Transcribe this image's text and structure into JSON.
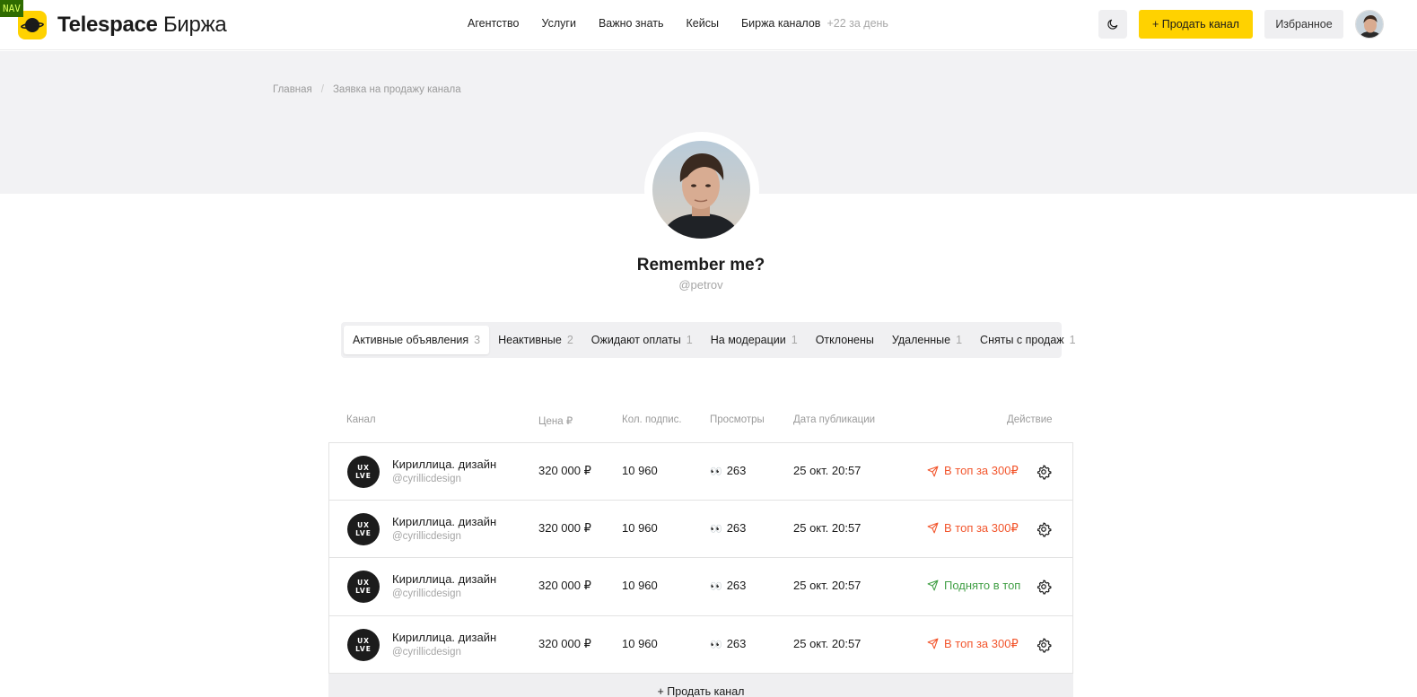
{
  "nav_tag": "NAV",
  "brand": {
    "name_bold": "Telespace",
    "name_light": "Биржа"
  },
  "menu": {
    "items": [
      "Агентство",
      "Услуги",
      "Важно знать",
      "Кейсы",
      "Биржа каналов"
    ],
    "exchange_extra": "+22 за день"
  },
  "header_actions": {
    "sell_label": "+ Продать канал",
    "favorites_label": "Избранное"
  },
  "breadcrumb": {
    "home": "Главная",
    "separator": "/",
    "current": "Заявка на продажу канала"
  },
  "profile": {
    "name": "Remember me?",
    "handle": "@petrov"
  },
  "tabs": [
    {
      "label": "Активные объявления",
      "count": "3",
      "active": true
    },
    {
      "label": "Неактивные",
      "count": "2"
    },
    {
      "label": "Ожидают оплаты",
      "count": "1"
    },
    {
      "label": "На модерации",
      "count": "1"
    },
    {
      "label": "Отклонены",
      "count": ""
    },
    {
      "label": "Удаленные",
      "count": "1"
    },
    {
      "label": "Сняты с продаж",
      "count": "1"
    }
  ],
  "table": {
    "columns": {
      "channel": "Канал",
      "price": "Цена ₽",
      "subscribers": "Кол. подпис.",
      "views": "Просмотры",
      "date": "Дата публикации",
      "action": "Действие"
    },
    "rows": [
      {
        "avatar_l1": "UX",
        "avatar_l2": "LVE",
        "title": "Кириллица. дизайн",
        "handle": "@cyrillicdesign",
        "price": "320 000 ₽",
        "subscribers": "10 960",
        "views": "263",
        "date": "25 окт. 20:57",
        "action": "В топ за 300₽",
        "action_state": "promo"
      },
      {
        "avatar_l1": "UX",
        "avatar_l2": "LVE",
        "title": "Кириллица. дизайн",
        "handle": "@cyrillicdesign",
        "price": "320 000 ₽",
        "subscribers": "10 960",
        "views": "263",
        "date": "25 окт. 20:57",
        "action": "В топ за 300₽",
        "action_state": "promo"
      },
      {
        "avatar_l1": "UX",
        "avatar_l2": "LVE",
        "title": "Кириллица. дизайн",
        "handle": "@cyrillicdesign",
        "price": "320 000 ₽",
        "subscribers": "10 960",
        "views": "263",
        "date": "25 окт. 20:57",
        "action": "Поднято в топ",
        "action_state": "done"
      },
      {
        "avatar_l1": "UX",
        "avatar_l2": "LVE",
        "title": "Кириллица. дизайн",
        "handle": "@cyrillicdesign",
        "price": "320 000 ₽",
        "subscribers": "10 960",
        "views": "263",
        "date": "25 окт. 20:57",
        "action": "В топ за 300₽",
        "action_state": "promo"
      }
    ]
  },
  "add_channel_label": "+ Продать канал",
  "colors": {
    "accent": "#ffd200",
    "promo": "#f2552c",
    "done": "#43a047"
  },
  "icons": {
    "theme": "moon-icon",
    "promo": "paper-plane-icon",
    "settings": "gear-icon",
    "views": "eyes-emoji"
  }
}
